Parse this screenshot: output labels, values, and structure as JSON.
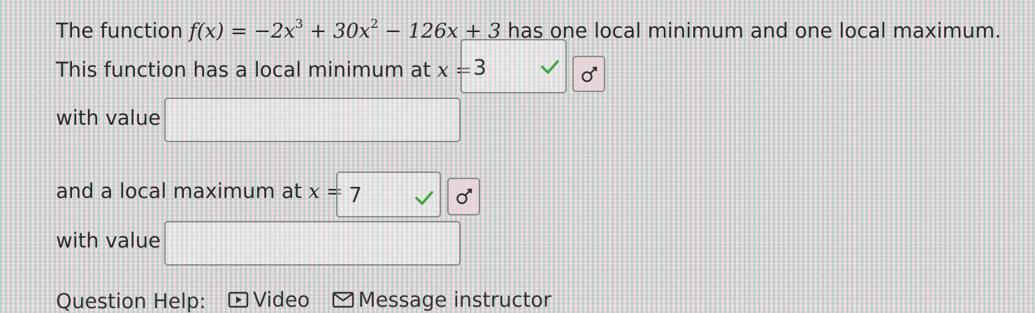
{
  "question": {
    "intro_prefix": "The function",
    "function_lhs": "f(x) =",
    "term1": "−2x",
    "term1_exp": "3",
    "term2": "+ 30x",
    "term2_exp": "2",
    "term3": "− 126x + 3",
    "intro_suffix": "has one local minimum and one local maximum."
  },
  "minimum": {
    "label": "This function has a local minimum at",
    "var": "x =",
    "answer": "3",
    "value_label": "with value",
    "value_answer": ""
  },
  "maximum": {
    "label": "and a local maximum at",
    "var": "x =",
    "answer": "7",
    "value_label": "with value",
    "value_answer": ""
  },
  "help": {
    "label": "Question Help:",
    "video": "Video",
    "message": "Message instructor"
  },
  "colors": {
    "check": "#3aa53a",
    "box_border": "#8a8a8a"
  },
  "icons": {
    "correct": "check-icon",
    "key": "key-icon",
    "video": "video-play-icon",
    "message": "envelope-icon"
  }
}
